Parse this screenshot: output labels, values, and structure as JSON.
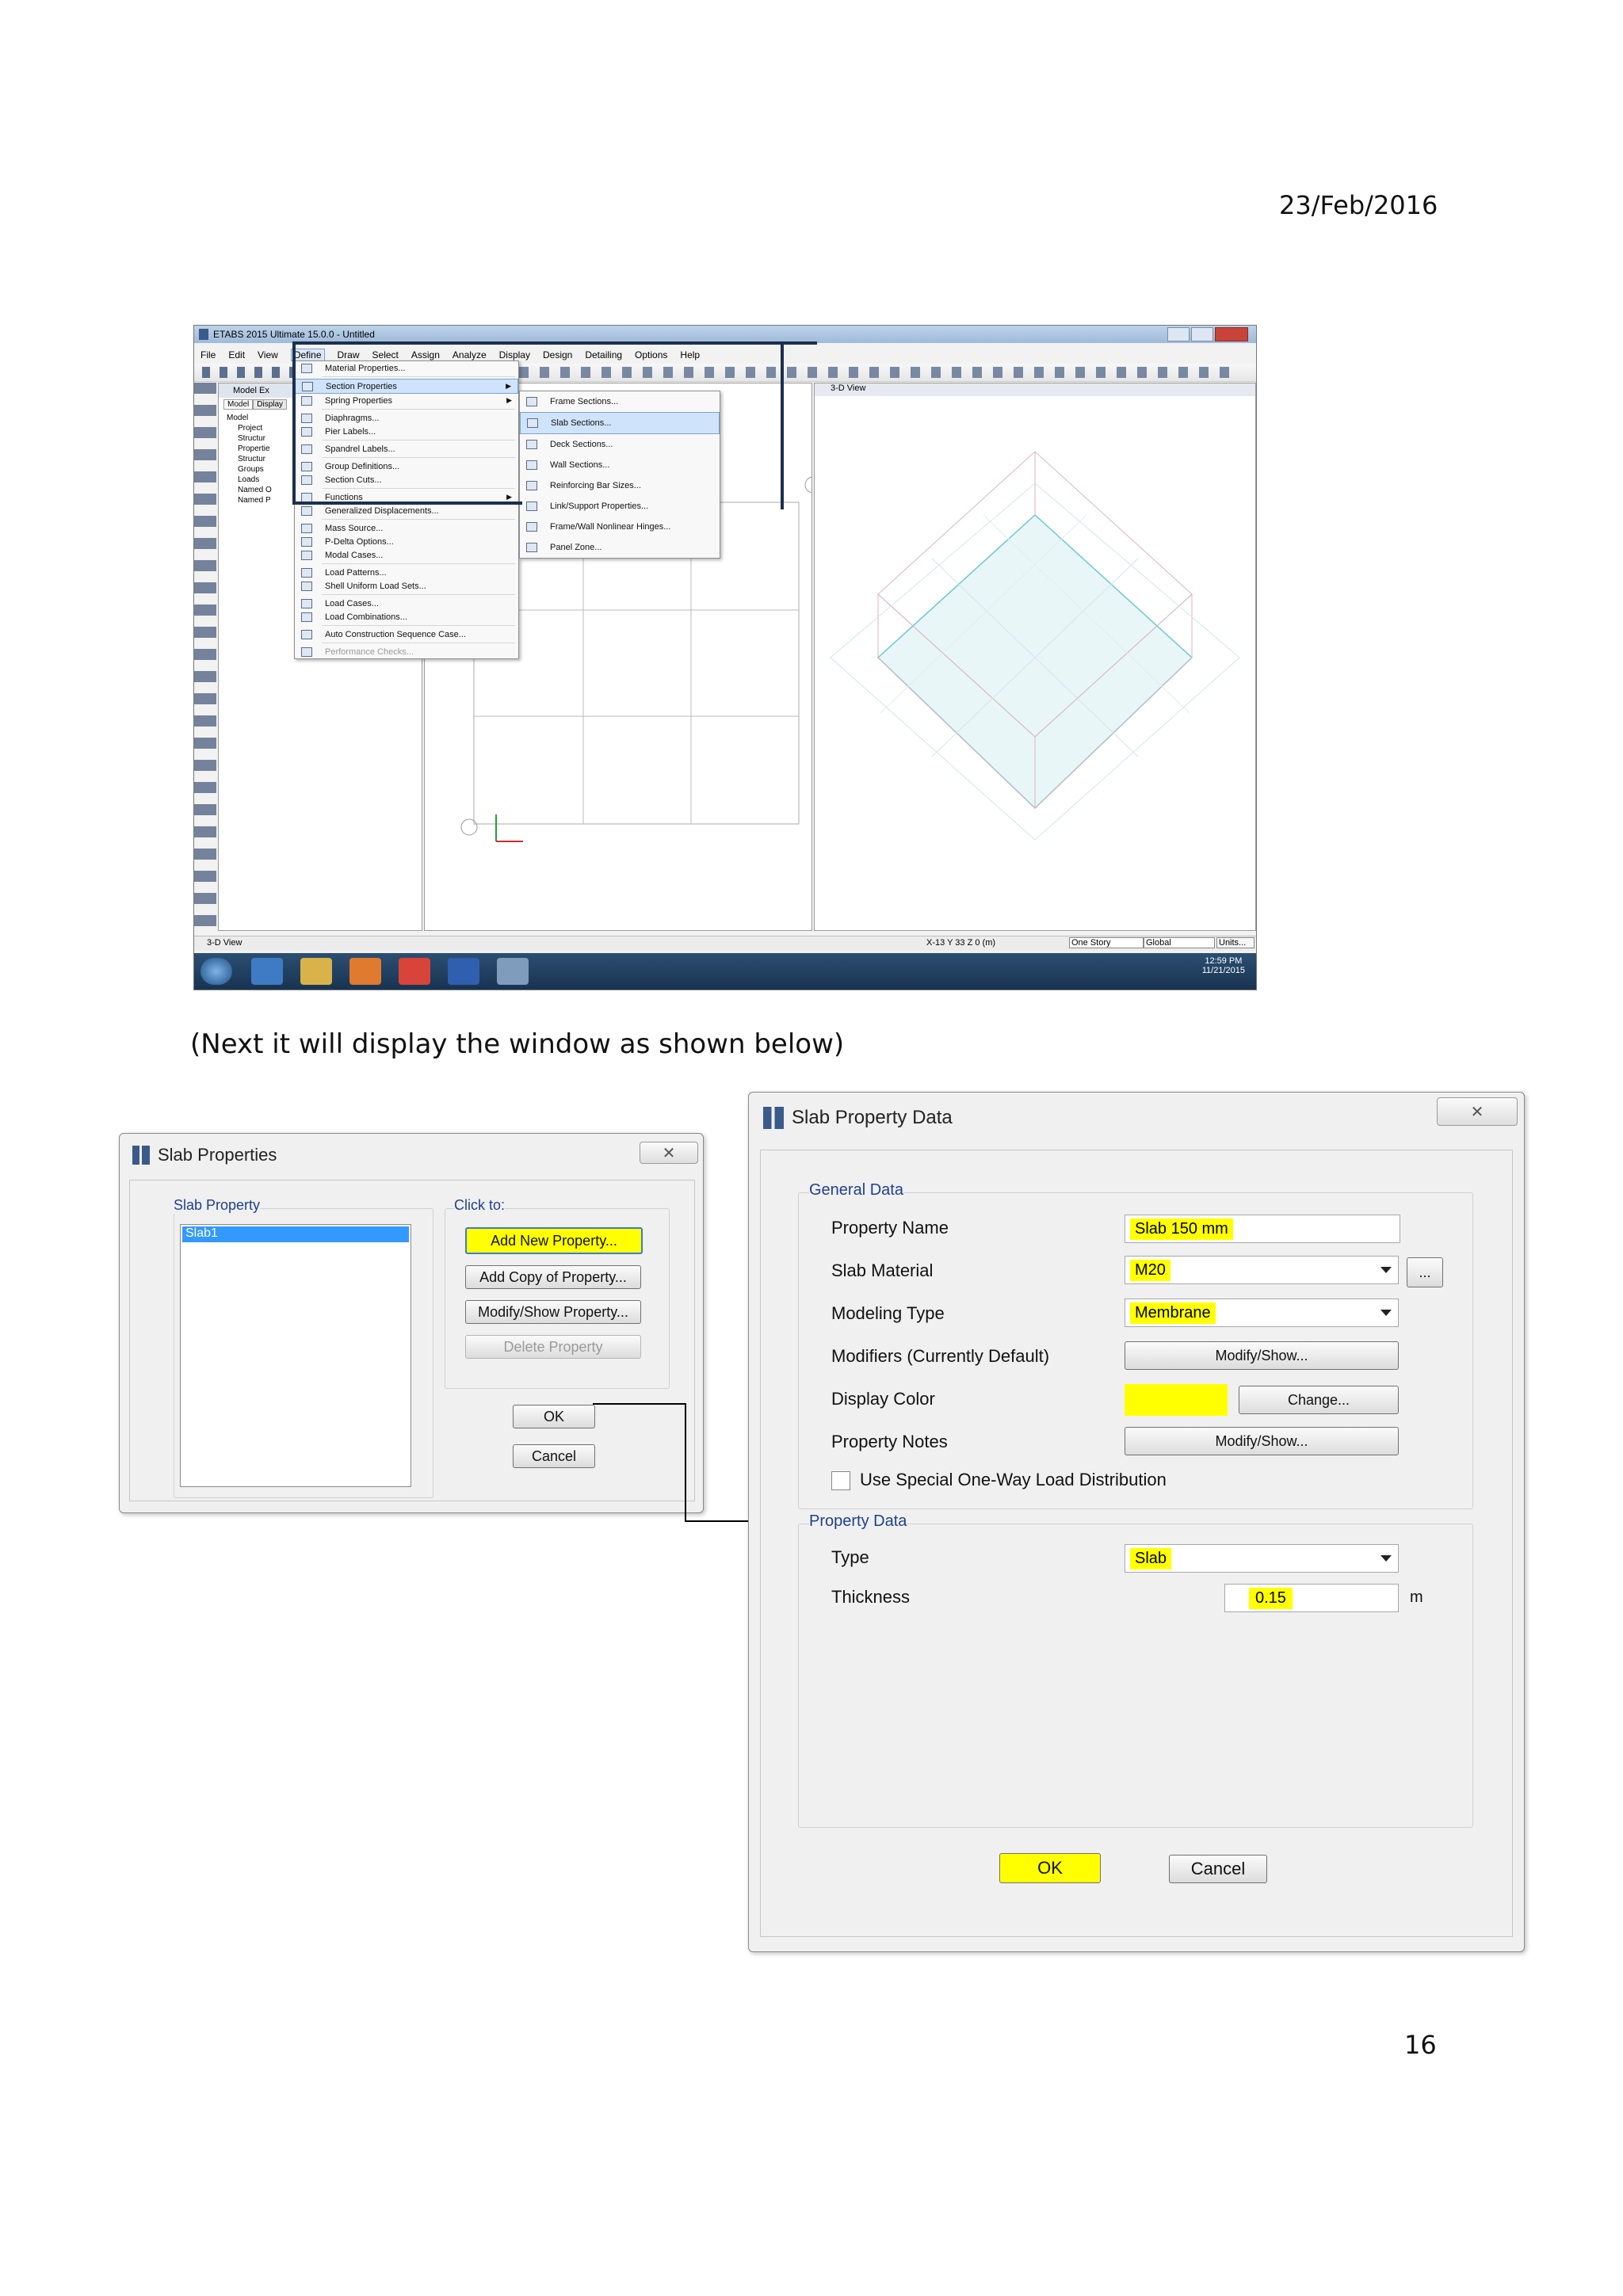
{
  "page": {
    "date": "23/Feb/2016",
    "caption": "(Next it will display the window as shown below)",
    "page_number": "16"
  },
  "etabs": {
    "title": "ETABS 2015 Ultimate 15.0.0 - Untitled",
    "menubar": [
      "File",
      "Edit",
      "View",
      "Define",
      "Draw",
      "Select",
      "Assign",
      "Analyze",
      "Display",
      "Design",
      "Detailing",
      "Options",
      "Help"
    ],
    "define_menu": [
      "Material Properties...",
      "Section Properties",
      "Spring Properties",
      "Diaphragms...",
      "Pier Labels...",
      "Spandrel Labels...",
      "Group Definitions...",
      "Section Cuts...",
      "Functions",
      "Generalized Displacements...",
      "Mass Source...",
      "P-Delta Options...",
      "Modal Cases...",
      "Load Patterns...",
      "Shell Uniform Load Sets...",
      "Load Cases...",
      "Load Combinations...",
      "Auto Construction Sequence Case...",
      "Performance Checks..."
    ],
    "section_submenu": [
      "Frame Sections...",
      "Slab Sections...",
      "Deck Sections...",
      "Wall Sections...",
      "Reinforcing Bar Sizes...",
      "Link/Support Properties...",
      "Frame/Wall Nonlinear Hinges...",
      "Panel Zone..."
    ],
    "explorer": {
      "title": "Model Ex",
      "tabs": [
        "Model",
        "Display"
      ],
      "tree": [
        "Model",
        "Project",
        "Structur",
        "Propertie",
        "Structur",
        "Groups",
        "Loads",
        "Named O",
        "Named P"
      ]
    },
    "view_title": "3-D View",
    "status_left": "3-D View",
    "status_coords": "X-13  Y 33  Z 0 (m)",
    "status_story": "One Story",
    "status_global": "Global",
    "status_units": "Units...",
    "clock_time": "12:59 PM",
    "clock_date": "11/21/2015"
  },
  "slab_properties": {
    "title": "Slab Properties",
    "list_label": "Slab Property",
    "list_items": [
      "Slab1"
    ],
    "click_to_label": "Click to:",
    "add_new": "Add New Property...",
    "add_copy": "Add Copy of Property...",
    "modify_show": "Modify/Show Property...",
    "delete": "Delete Property",
    "ok": "OK",
    "cancel": "Cancel"
  },
  "slab_property_data": {
    "title": "Slab Property Data",
    "general_label": "General Data",
    "property_name_label": "Property Name",
    "property_name_value": "Slab 150 mm",
    "slab_material_label": "Slab Material",
    "slab_material_value": "M20",
    "modeling_type_label": "Modeling Type",
    "modeling_type_value": "Membrane",
    "modifiers_label": "Modifiers (Currently Default)",
    "display_color_label": "Display Color",
    "property_notes_label": "Property Notes",
    "modify_show": "Modify/Show...",
    "change": "Change...",
    "ellipsis": "...",
    "checkbox_label": "Use Special One-Way Load Distribution",
    "property_data_label": "Property Data",
    "type_label": "Type",
    "type_value": "Slab",
    "thickness_label": "Thickness",
    "thickness_value": "0.15",
    "thickness_unit": "m",
    "ok": "OK",
    "cancel": "Cancel",
    "display_color": "#ffff00"
  },
  "colors": {
    "highlight": "#ffff00",
    "group_label": "#1f3f8f",
    "annotation_line": "#1c2f4f",
    "menu_selection": "#cfe3fb"
  }
}
